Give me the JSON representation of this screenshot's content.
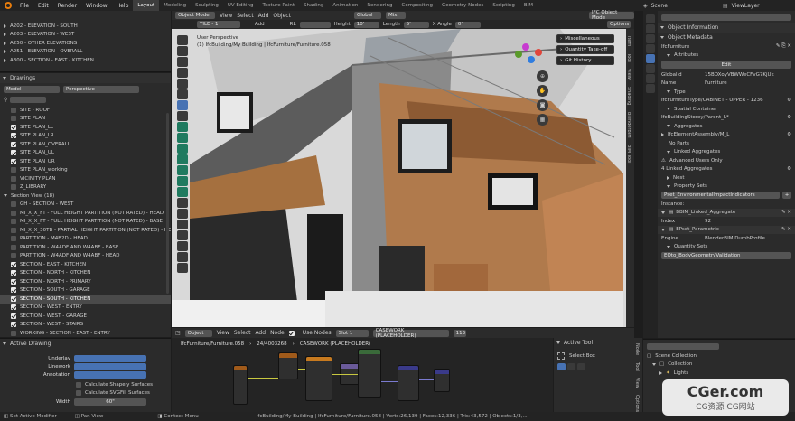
{
  "menubar": {
    "menus": [
      "File",
      "Edit",
      "Render",
      "Window",
      "Help"
    ],
    "workspaces": [
      "Layout",
      "Modeling",
      "Sculpting",
      "UV Editing",
      "Texture Paint",
      "Shading",
      "Animation",
      "Rendering",
      "Compositing",
      "Geometry Nodes",
      "Scripting",
      "BIM"
    ],
    "active_workspace": "Layout",
    "scene_label": "Scene",
    "view_layer_label": "ViewLayer"
  },
  "outliner_drawings": {
    "top_items": [
      "A202 - ELEVATION - SOUTH",
      "A203 - ELEVATION - WEST",
      "A250 - OTHER ELEVATIONS",
      "A251 - ELEVATION - OVERALL",
      "A300 - SECTION - EAST - KITCHEN"
    ],
    "header_label": "Drawings",
    "target_value": "Model",
    "target_view": "Perspective",
    "items": [
      {
        "label": "SITE - ROOF",
        "checked": false
      },
      {
        "label": "SITE PLAN",
        "checked": false
      },
      {
        "label": "SITE PLAN_LL",
        "checked": true
      },
      {
        "label": "SITE PLAN_LR",
        "checked": true
      },
      {
        "label": "SITE PLAN_OVERALL",
        "checked": true
      },
      {
        "label": "SITE PLAN_UL",
        "checked": true
      },
      {
        "label": "SITE PLAN_UR",
        "checked": true
      },
      {
        "label": "SITE PLAN_working",
        "checked": false
      },
      {
        "label": "VICINITY PLAN",
        "checked": false
      },
      {
        "label": "Z_LIBRARY",
        "checked": false
      },
      {
        "label": "Section View (18)",
        "checked": null
      },
      {
        "label": "GH - SECTION - WEST",
        "checked": false
      },
      {
        "label": "MI_X_X_FT - FULL HEIGHT PARTITION (NOT RATED) - HEAD",
        "checked": false
      },
      {
        "label": "MI_X_X_FT - FULL HEIGHT PARTITION (NOT RATED) - BASE",
        "checked": false
      },
      {
        "label": "MI_X_X_30TB - PARTIAL HEIGHT PARTITION (NOT RATED) - HEAD",
        "checked": false
      },
      {
        "label": "PARTITION - M4B2D - HEAD",
        "checked": false
      },
      {
        "label": "PARTITION - W4ADF AND W4ABF - BASE",
        "checked": false
      },
      {
        "label": "PARTITION - W4ADF AND W4ABF - HEAD",
        "checked": false
      },
      {
        "label": "SECTION - EAST - KITCHEN",
        "checked": true
      },
      {
        "label": "SECTION - NORTH - KITCHEN",
        "checked": true
      },
      {
        "label": "SECTION - NORTH - PRIMARY",
        "checked": true
      },
      {
        "label": "SECTION - SOUTH - GARAGE",
        "checked": true
      },
      {
        "label": "SECTION - SOUTH - KITCHEN",
        "checked": true,
        "selected": true
      },
      {
        "label": "SECTION - WEST - ENTRY",
        "checked": true
      },
      {
        "label": "SECTION - WEST - GARAGE",
        "checked": true
      },
      {
        "label": "SECTION - WEST - STAIRS",
        "checked": true
      },
      {
        "label": "WORKING - SECTION - EAST - ENTRY",
        "checked": false
      }
    ]
  },
  "active_drawing": {
    "title": "Active Drawing",
    "rows": [
      {
        "label": "Underlay"
      },
      {
        "label": "Linework"
      },
      {
        "label": "Annotation"
      }
    ],
    "calc_shapely": "Calculate Shapely Surfaces",
    "calc_svgfill": "Calculate SVGFill Surfaces",
    "width_label": "Width",
    "width_value": "60\""
  },
  "viewport": {
    "mode": "Object Mode",
    "menus": [
      "View",
      "Select",
      "Add",
      "Object"
    ],
    "orientation": "Global",
    "mix_label": "Mix",
    "ifc_mode": "IFC Object Mode",
    "tile_label": "TILE - 1",
    "add_label": "Add",
    "rl_label": "RL",
    "height_label": "Height",
    "height_value": "10'",
    "length_label": "Length",
    "length_value": "5'",
    "xangle_label": "X Angle",
    "xangle_value": "0°",
    "options_label": "Options",
    "view_name": "User Perspective",
    "view_path": "(1) IfcBuilding/My Building | IfcFurniture/Furniture.058",
    "popup_buttons": [
      "Miscellaneous",
      "Quantity Take-off",
      "Git History"
    ],
    "side_tabs": [
      "Item",
      "Tool",
      "View",
      "Shading",
      "BlenderBIM",
      "BIM Tool",
      "Instant Clean",
      "BlenderBIM | Geometry"
    ]
  },
  "node_editor": {
    "editor_type": "Object",
    "menus": [
      "View",
      "Select",
      "Add",
      "Node"
    ],
    "use_nodes_label": "Use Nodes",
    "slot_label": "Slot 1",
    "material_name": "CASEWORK (PLACEHOLDER)",
    "user_count": "113",
    "breadcrumb_object": "IfcFurniture/Furniture.058",
    "breadcrumb_id": "24/4003268",
    "breadcrumb_material": "CASEWORK (PLACEHOLDER)",
    "active_tool_title": "Active Tool",
    "active_tool_name": "Select Box",
    "side_tabs": [
      "Node",
      "Tool",
      "View",
      "Options"
    ]
  },
  "properties": {
    "title": "Object Information",
    "object_metadata": "Object Metadata",
    "entity_name": "IfcFurniture",
    "attributes": "Attributes",
    "edit_label": "Edit",
    "global_id_label": "GlobalId",
    "global_id_value": "15BOXoyVBWWeCFvG7KjUk",
    "name_label": "Name",
    "name_value": "Furniture",
    "type_label": "Type",
    "type_value": "IfcFurnitureType/CABINET - UPPER - 1236",
    "spatial_label": "Spatial Container",
    "spatial_value": "IfcBuildingStorey/Parent_L*",
    "aggregates_label": "Aggregates",
    "aggregate_value": "IfcElementAssembly/M_L",
    "no_parts": "No Parts",
    "linked_aggregates": "Linked Aggregates",
    "advanced_users": "Advanced Users Only",
    "linked_count": "4 Linked Aggregates",
    "nest_label": "Nest",
    "property_sets": "Property Sets",
    "pset_name": "Pset_EnvironmentalImpactIndicators",
    "instance_label": "Instance:",
    "pset1": "BBIM_Linked_Aggregate",
    "index_label": "Index",
    "index_value": "92",
    "pset2": "EPset_Parametric",
    "engine_label": "Engine",
    "engine_value": "BlenderBIM.DumbProfile",
    "quantity_sets": "Quantity Sets",
    "qto_name": "EQto_BodyGeometryValidation"
  },
  "scene_outliner": {
    "title": "Scene Collection",
    "items": [
      "Collection",
      "Lights"
    ]
  },
  "statusbar": {
    "left": [
      "Set Active Modifier",
      "Pan View",
      "Context Menu"
    ],
    "right": "IfcBuilding/My Building | IfcFurniture/Furniture.058 | Verts:26,139 | Faces:12,336 | Tris:43,572 | Objects:1/3,..."
  },
  "watermark": {
    "main": "CGer.com",
    "sub": "CG资源 CG网站"
  }
}
